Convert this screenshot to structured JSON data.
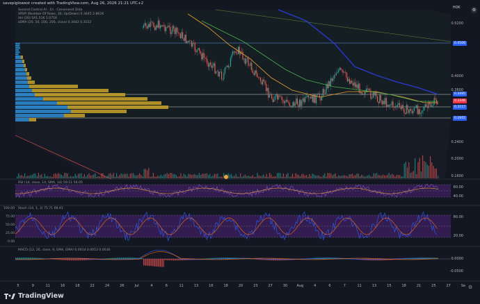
{
  "header": {
    "credit": "savepiglowest created with TradingView.com, Aug 26, 2026 21:21 UTC+2",
    "exchange_label": "HOK"
  },
  "legends": {
    "main": "Second Control AI · 1h · Cenomand Dida",
    "vrvp": "VRVP (Number Of Rows, 30, Up/Down) 0.3445 2.861K",
    "vol": "Vol (20) 5A1.51K 1.071K",
    "sma": "sEMA (20, 50, 100, 200, close) 0.3442 0.3152",
    "rsi": "RSI (14, close, 14, SMA, 14) 59.11 56.05",
    "stoch": "Stoch (14, 1, 3) 75.71 68.41",
    "macd": "MACD (12, 26, close, 9, EMA, EMA) 0.0014 0.0053 0.0036"
  },
  "price_axis": {
    "labels": [
      "0.5200",
      "0.4000",
      "0.3600",
      "0.2400",
      "0.2000",
      "0.1600"
    ],
    "tags": [
      {
        "text": "0.4506",
        "color": "#2962ff"
      },
      {
        "text": "0.3495",
        "color": "#2962ff"
      },
      {
        "text": "0.3346",
        "color": "#f23645"
      },
      {
        "text": "0.3157",
        "color": "#2962ff"
      },
      {
        "text": "0.2955",
        "color": "#2962ff"
      }
    ]
  },
  "rsi_axis": [
    "60.00",
    "40.00"
  ],
  "stoch_axis": [
    "100.00",
    "75.00",
    "50.00",
    "25.00",
    "0.00"
  ],
  "stoch_axis_right": [
    "80.00",
    "20.00"
  ],
  "macd_axis": [
    "0.0000",
    "-0.0500"
  ],
  "x_axis": [
    "5",
    "9",
    "11",
    "16",
    "18",
    "22",
    "24",
    "26",
    "Jul",
    "4",
    "6",
    "11",
    "13",
    "16",
    "18",
    "20",
    "23",
    "27",
    "30",
    "Aug",
    "4",
    "6",
    "7",
    "11",
    "13",
    "15",
    "18",
    "21",
    "25",
    "27",
    "Se"
  ],
  "footer": {
    "brand": "TradingView"
  },
  "colors": {
    "bg": "#131722",
    "up": "#26a69a",
    "down": "#ef5350",
    "ma_orange": "#f0a030",
    "ma_green": "#4caf50",
    "ma_blue": "#2a38d6",
    "vp_blue": "#2b8cd8",
    "vp_gold": "#c9a227",
    "rsi_band": "#3a1f58"
  }
}
